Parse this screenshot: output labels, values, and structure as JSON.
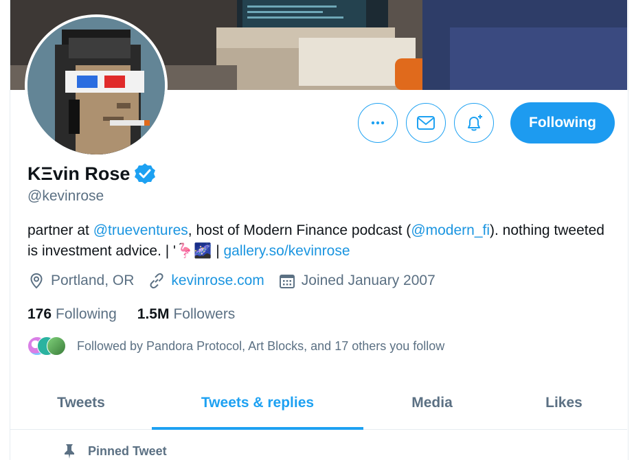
{
  "profile": {
    "name": "KΞvin Rose",
    "handle": "@kevinrose",
    "bio": {
      "t1": "partner at ",
      "link1": "@trueventures",
      "t2": ", host of Modern Finance podcast (",
      "link2": "@modern_fi",
      "t3": "). nothing tweeted is investment advice. | '",
      "emoji1": "🦩",
      "emoji2": "🌌",
      "t4": " | ",
      "link3": "gallery.so/kevinrose"
    },
    "location": "Portland, OR",
    "website": "kevinrose.com",
    "joined": "Joined January 2007",
    "following_count": "176",
    "following_label": "Following",
    "followers_count": "1.5M",
    "followers_label": "Followers",
    "followed_by": "Followed by Pandora Protocol, Art Blocks, and 17 others you follow"
  },
  "actions": {
    "more_label": "More",
    "message_label": "Message",
    "notify_label": "Turn on notifications",
    "follow_label": "Following"
  },
  "tabs": [
    {
      "label": "Tweets",
      "active": false
    },
    {
      "label": "Tweets & replies",
      "active": true
    },
    {
      "label": "Media",
      "active": false
    },
    {
      "label": "Likes",
      "active": false
    }
  ],
  "pinned": {
    "label": "Pinned Tweet"
  },
  "colors": {
    "accent": "#1da1f2",
    "secondary_text": "#5b7083",
    "primary_text": "#0f1419"
  }
}
